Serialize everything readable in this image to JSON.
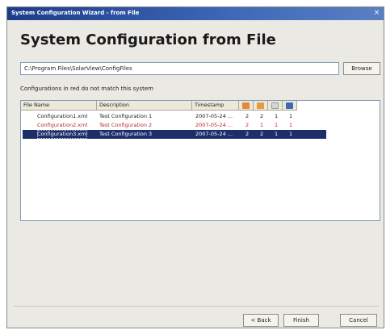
{
  "window": {
    "title": "System Configuration Wizard - from File",
    "close_glyph": "×"
  },
  "heading": "System Configuration from File",
  "path": {
    "value": "C:\\Program Files\\SolarView\\ConfigFiles"
  },
  "buttons": {
    "browse": "Browse",
    "back": "< Back",
    "finish": "Finish",
    "cancel": "Cancel"
  },
  "note": "Configurations in red do not match this system",
  "table": {
    "columns": [
      "File Name",
      "Description",
      "Timestamp"
    ],
    "icon_columns": [
      {
        "icon": "orange-device-icon",
        "color": "#e8873a"
      },
      {
        "icon": "orange-module-icon",
        "color": "#e59a44"
      },
      {
        "icon": "gray-sensor-icon",
        "color": "#d6d6d6"
      },
      {
        "icon": "blue-display-icon",
        "color": "#3d6ab3"
      }
    ],
    "rows": [
      {
        "file": "Configuration1.xml",
        "description": "Test Configuration 1",
        "timestamp": "2007-05-24 ...",
        "c1": "2",
        "c2": "2",
        "c3": "1",
        "c4": "1",
        "state": "normal"
      },
      {
        "file": "Configuration2.xml",
        "description": "Test Configuration 2",
        "timestamp": "2007-05-24 ...",
        "c1": "2",
        "c2": "1",
        "c3": "1",
        "c4": "1",
        "state": "mismatch"
      },
      {
        "file": "Configuration3.xml",
        "description": "Test Configuration 3",
        "timestamp": "2007-05-24 ...",
        "c1": "2",
        "c2": "2",
        "c3": "1",
        "c4": "1",
        "state": "selected"
      }
    ]
  },
  "colors": {
    "mismatch_text": "#b8262a",
    "selection_bg": "#1c2f6b",
    "titlebar": "#1c3c8a"
  }
}
